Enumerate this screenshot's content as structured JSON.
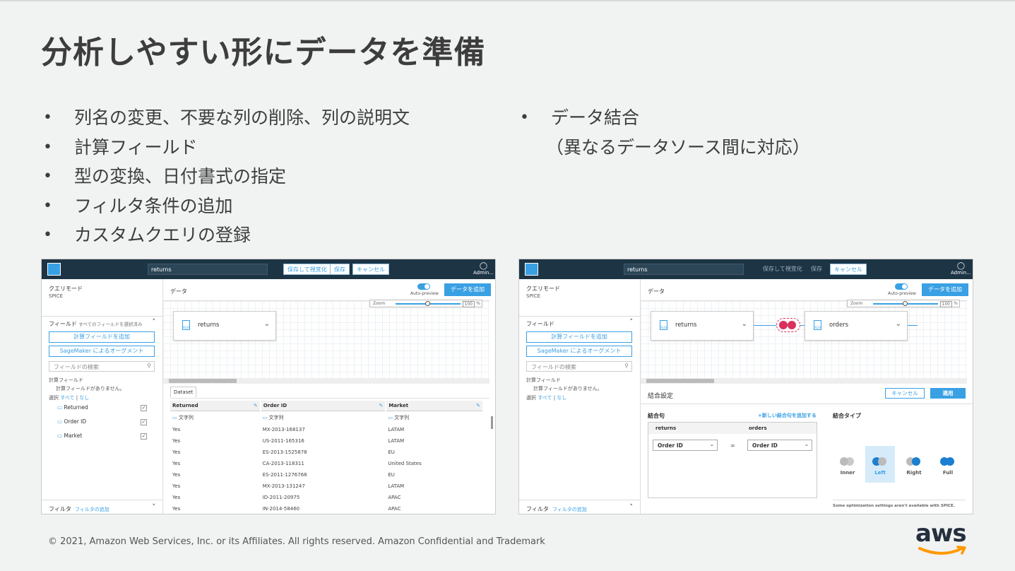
{
  "title": "分析しやすい形にデータを準備",
  "bullets_left": [
    "列名の変更、不要な列の削除、列の説明文",
    "計算フィールド",
    "型の変換、日付書式の指定",
    "フィルタ条件の追加",
    "カスタムクエリの登録"
  ],
  "bullets_right": [
    "データ結合",
    "（異なるデータソース間に対応）"
  ],
  "footer": "© 2021, Amazon Web Services, Inc. or its Affiliates. All rights reserved. Amazon Confidential and Trademark",
  "logo": "aws",
  "shot1": {
    "search_value": "returns",
    "btn_save_visualize": "保存して視覚化",
    "btn_save": "保存",
    "btn_cancel": "キャンセル",
    "admin": "Admin...",
    "query_mode_label": "クエリモード",
    "query_mode_value": "SPICE",
    "fields_label": "フィールド",
    "fields_select_all": "すべてのフィールドを選択済み",
    "add_calc_field": "計算フィールドを追加",
    "sagemaker": "SageMaker によるオーグメント",
    "field_search_placeholder": "フィールドの検索",
    "calc_fields_label": "計算フィールド",
    "no_calc_fields": "計算フィールドがありません。",
    "select_label": "選択",
    "select_all": "すべて",
    "select_none": "なし",
    "fields": [
      "Returned",
      "Order ID",
      "Market"
    ],
    "filter_label": "フィルタ",
    "filter_add": "フィルタの追加",
    "data_label": "データ",
    "auto_preview": "Auto-preview",
    "add_data": "データを追加",
    "zoom_label": "Zoom",
    "zoom_value": "100",
    "zoom_unit": "%",
    "dataset_node": "returns",
    "dataset_tab": "Dataset",
    "columns": [
      "Returned",
      "Order ID",
      "Market"
    ],
    "type_row": [
      "文字列",
      "文字列",
      "文字列"
    ],
    "rows": [
      [
        "Yes",
        "MX-2013-168137",
        "LATAM"
      ],
      [
        "Yes",
        "US-2011-165316",
        "LATAM"
      ],
      [
        "Yes",
        "ES-2013-1525878",
        "EU"
      ],
      [
        "Yes",
        "CA-2013-118311",
        "United States"
      ],
      [
        "Yes",
        "ES-2011-1276768",
        "EU"
      ],
      [
        "Yes",
        "MX-2013-131247",
        "LATAM"
      ],
      [
        "Yes",
        "ID-2011-20975",
        "APAC"
      ],
      [
        "Yes",
        "IN-2014-58460",
        "APAC"
      ]
    ]
  },
  "shot2": {
    "search_value": "returns",
    "btn_save_visualize": "保存して視覚化",
    "btn_save": "保存",
    "btn_cancel": "キャンセル",
    "admin": "Admin...",
    "query_mode_label": "クエリモード",
    "query_mode_value": "SPICE",
    "fields_label": "フィールド",
    "add_calc_field": "計算フィールドを追加",
    "sagemaker": "SageMaker によるオーグメント",
    "field_search_placeholder": "フィールドの検索",
    "calc_fields_label": "計算フィールド",
    "no_calc_fields": "計算フィールドがありません。",
    "select_label": "選択",
    "select_all": "すべて",
    "select_none": "なし",
    "filter_label": "フィルタ",
    "filter_add": "フィルタの追加",
    "data_label": "データ",
    "auto_preview": "Auto-preview",
    "add_data": "データを追加",
    "zoom_label": "Zoom",
    "zoom_value": "100",
    "zoom_unit": "%",
    "node_left": "returns",
    "node_right": "orders",
    "join_settings": "結合設定",
    "join_cancel": "キャンセル",
    "join_apply": "適用",
    "join_clause": "結合句",
    "add_join_clause": "+新しい結合句を追加する",
    "join_type": "結合タイプ",
    "clause_left_header": "returns",
    "clause_right_header": "orders",
    "clause_left": "Order ID",
    "clause_eq": "=",
    "clause_right": "Order ID",
    "join_types": [
      "Inner",
      "Left",
      "Right",
      "Full"
    ],
    "join_note": "Some optimization settings aren't available with SPICE."
  }
}
